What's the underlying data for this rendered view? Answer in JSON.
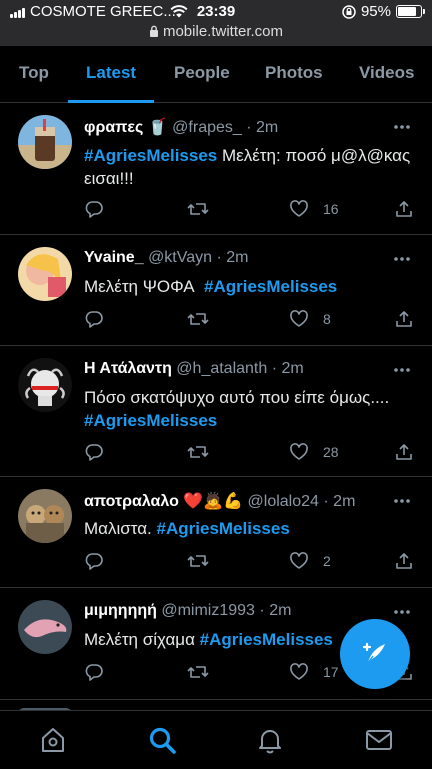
{
  "status_bar": {
    "carrier": "COSMOTE GREEC...",
    "time": "23:39",
    "battery": "95%",
    "url": "mobile.twitter.com"
  },
  "tabs": [
    {
      "label": "Top"
    },
    {
      "label": "Latest",
      "active": true
    },
    {
      "label": "People"
    },
    {
      "label": "Photos"
    },
    {
      "label": "Videos"
    }
  ],
  "tweets": [
    {
      "name": "φραπες",
      "emoji": "🥤",
      "handle": "@frapes_",
      "sep": "·",
      "time": "2m",
      "hashtag": "#AgriesMelisses",
      "text": "Μελέτη: ποσό μ@λ@κας εισαι!!!",
      "likes": "16",
      "retweets": ""
    },
    {
      "name": "Yvaine_",
      "emoji": "",
      "handle": "@ktVayn",
      "sep": "·",
      "time": "2m",
      "hashtag": "#AgriesMelisses",
      "text": "Μελέτη ΨΟΦΑ",
      "likes": "8",
      "retweets": ""
    },
    {
      "name": "Η Ατάλαντη",
      "emoji": "",
      "handle": "@h_atalanth",
      "sep": "·",
      "time": "2m",
      "hashtag": "#AgriesMelisses",
      "text": "Πόσο σκατόψυχο αυτό που είπε όμως....",
      "likes": "28",
      "retweets": ""
    },
    {
      "name": "αποτραλαλο",
      "emoji": "❤️🙇💪",
      "handle": "@lolalo24",
      "sep": "·",
      "time": "2m",
      "hashtag": "#AgriesMelisses",
      "text": "Μαλιστα.",
      "likes": "2",
      "retweets": ""
    },
    {
      "name": "μιμηηηηή",
      "emoji": "",
      "handle": "@mimiz1993",
      "sep": "·",
      "time": "2m",
      "hashtag": "#AgriesMelisses",
      "text": "Μελέτη σίχαμα",
      "likes": "17",
      "retweets": ""
    }
  ],
  "icons": {
    "reply": "reply-icon",
    "retweet": "retweet-icon",
    "like": "heart-icon",
    "share": "share-icon",
    "more": "more-dots-icon",
    "compose": "compose-feather-icon",
    "home": "home-icon",
    "search": "search-icon",
    "notifications": "bell-icon",
    "messages": "mail-icon"
  },
  "colors": {
    "accent": "#1d9bf0",
    "background": "#000000",
    "secondary_text": "#8b98a5"
  }
}
